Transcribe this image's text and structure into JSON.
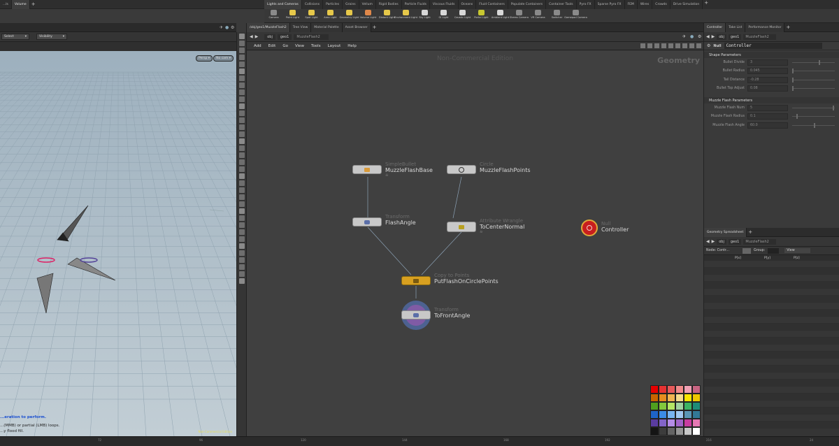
{
  "shelf_left_tabs": [
    {
      "label": "...ls"
    },
    {
      "label": "Volume"
    }
  ],
  "shelf_main_tabs": [
    "Lights and Cameras",
    "Collisions",
    "Particles",
    "Grains",
    "Vellum",
    "Rigid Bodies",
    "Particle Fluids",
    "Viscous Fluids",
    "Oceans",
    "Fluid Containers",
    "Populate Containers",
    "Container Tools",
    "Pyro FX",
    "Sparse Pyro FX",
    "FEM",
    "Wires",
    "Crowds",
    "Drive Simulation"
  ],
  "shelf_tools": [
    {
      "label": "Camera",
      "icon": "camera-icon",
      "color": "#8a8a8a"
    },
    {
      "label": "Point Light",
      "icon": "point-light-icon",
      "color": "#e6c84a"
    },
    {
      "label": "Spot Light",
      "icon": "spot-light-icon",
      "color": "#e6c84a"
    },
    {
      "label": "Area Light",
      "icon": "area-light-icon",
      "color": "#e6c84a"
    },
    {
      "label": "Geometry Light",
      "icon": "geometry-light-icon",
      "color": "#e6c84a"
    },
    {
      "label": "Volume Light",
      "icon": "volume-light-icon",
      "color": "#e0884a"
    },
    {
      "label": "Distant Light",
      "icon": "distant-light-icon",
      "color": "#e6c84a"
    },
    {
      "label": "Environment Light",
      "icon": "environment-light-icon",
      "color": "#e6c84a"
    },
    {
      "label": "Sky Light",
      "icon": "sky-light-icon",
      "color": "#d8d8d8"
    },
    {
      "label": "GI Light",
      "icon": "gi-light-icon",
      "color": "#d8d8d8"
    },
    {
      "label": "Caustic Light",
      "icon": "caustic-light-icon",
      "color": "#d8d8d8"
    },
    {
      "label": "Portal Light",
      "icon": "portal-light-icon",
      "color": "#c7c730"
    },
    {
      "label": "Ambient Light",
      "icon": "ambient-light-icon",
      "color": "#d8d8d8"
    },
    {
      "label": "Stereo Camera",
      "icon": "stereo-camera-icon",
      "color": "#8a8a8a"
    },
    {
      "label": "VR Camera",
      "icon": "vr-camera-icon",
      "color": "#8a8a8a"
    },
    {
      "label": "Switcher",
      "icon": "switcher-icon",
      "color": "#8a8a8a"
    },
    {
      "label": "Gamepad Camera",
      "icon": "gamepad-camera-icon",
      "color": "#8a8a8a"
    }
  ],
  "network_tabs": [
    "/obj/geo1/MuzzleFlash2",
    "Tree View",
    "Material Palette",
    "Asset Browser"
  ],
  "path": {
    "root": "obj",
    "geo": "geo1",
    "node": "MuzzleFlash2"
  },
  "net_menu": [
    "Add",
    "Edit",
    "Go",
    "View",
    "Tools",
    "Layout",
    "Help"
  ],
  "net_watermark": "Non-Commercial Edition",
  "net_context": "Geometry",
  "nodes": [
    {
      "id": "muzzleflashbase",
      "type": "SimpleBullet",
      "name": "MuzzleFlashBase"
    },
    {
      "id": "muzzleflashpoints",
      "type": "Circle",
      "name": "MuzzleFlashPoints"
    },
    {
      "id": "flashangle",
      "type": "Transform",
      "name": "FlashAngle"
    },
    {
      "id": "tocenternormal",
      "type": "Attribute Wrangle",
      "name": "ToCenterNormal"
    },
    {
      "id": "controller",
      "type": "Null",
      "name": "Controller"
    },
    {
      "id": "putflash",
      "type": "Copy to Points",
      "name": "PutFlashOnCirclePoints"
    },
    {
      "id": "tofrontangle",
      "type": "Transform",
      "name": "ToFrontAngle"
    }
  ],
  "viewport": {
    "select_label": "Select",
    "visibility_label": "Visibility",
    "persp": "Persp ▾",
    "cam": "No cam ▾",
    "status1": "...eration to perform.",
    "status2": "...(MMB) or partial (LMB) loops.",
    "status3": "...y flood fill.",
    "badge": "Non-Commercial Edition"
  },
  "params": {
    "tabs": [
      "Controller",
      "Take List",
      "Performance Monitor"
    ],
    "node_type": "Null",
    "node_name": "Controller",
    "sections": [
      {
        "title": "Shape Parameters",
        "rows": [
          {
            "label": "Bullet Divide",
            "value": "3",
            "knob": 0.62
          },
          {
            "label": "Bullet Radius",
            "value": "0.045",
            "knob": 0.0
          },
          {
            "label": "Tail Distance",
            "value": "-0.28",
            "knob": 0.0
          },
          {
            "label": "Bullet Top Adjust",
            "value": "0.08",
            "knob": 0.0
          }
        ]
      },
      {
        "title": "Muzzle Flash Parameters",
        "rows": [
          {
            "label": "Muzzle Flash Num",
            "value": "5",
            "knob": 0.95
          },
          {
            "label": "Muzzle Flash Radius",
            "value": "0.1",
            "knob": 0.1
          },
          {
            "label": "Muzzle Flash Angle",
            "value": "60.0",
            "knob": 0.5
          }
        ]
      }
    ]
  },
  "spreadsheet": {
    "tab": "Geometry Spreadsheet",
    "node_label": "Node: Contr...",
    "group_label": "Group:",
    "view_label": "View",
    "cols": [
      "P[x]",
      "P[y]",
      "P[z]"
    ]
  },
  "timeline_ticks": [
    "72",
    "96",
    "120",
    "144",
    "168",
    "192",
    "216",
    "24"
  ],
  "palette": [
    "#e60000",
    "#e63232",
    "#e65a5a",
    "#f08a8a",
    "#f0a0b4",
    "#c86482",
    "#c86400",
    "#e68c1e",
    "#f0b450",
    "#f5dc8c",
    "#fae600",
    "#f0c800",
    "#50a01e",
    "#82c83c",
    "#b4e664",
    "#a0d2a0",
    "#3cb464",
    "#1e8c78",
    "#1e64c8",
    "#3c8ce6",
    "#78b4f0",
    "#a0c8f0",
    "#5a96b4",
    "#327896",
    "#5a3ca0",
    "#8264c8",
    "#b48ce6",
    "#a064c8",
    "#c83ca0",
    "#e678b4",
    "#141414",
    "#3c3c3c",
    "#646464",
    "#969696",
    "#c8c8c8",
    "#ffffff"
  ]
}
